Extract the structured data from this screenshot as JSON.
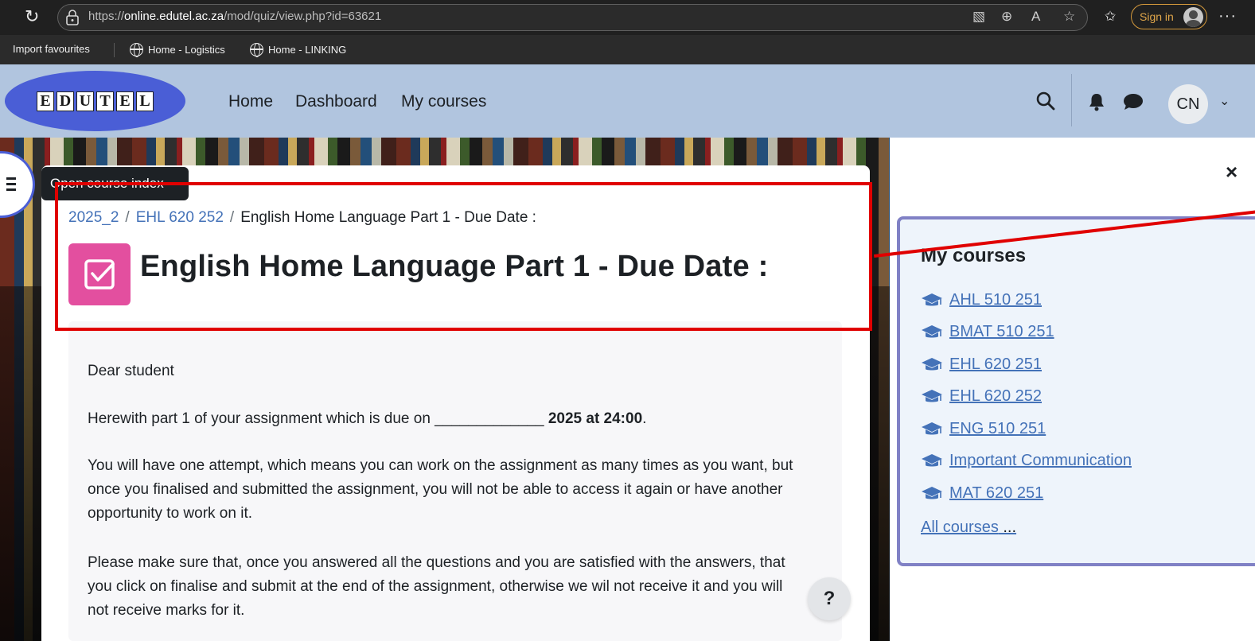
{
  "browser": {
    "url_prefix": "https://",
    "url_domain": "online.edutel.ac.za",
    "url_path": "/mod/quiz/view.php?id=63621",
    "sign_in_label": "Sign in",
    "favourites": [
      {
        "label": "Import favourites"
      },
      {
        "label": "Home - Logistics"
      },
      {
        "label": "Home - LINKING"
      }
    ]
  },
  "navbar": {
    "logo_letters": [
      "E",
      "D",
      "U",
      "T",
      "E",
      "L"
    ],
    "links": [
      {
        "label": "Home"
      },
      {
        "label": "Dashboard"
      },
      {
        "label": "My courses"
      }
    ],
    "user_initials": "CN"
  },
  "course_index": {
    "tooltip": "Open course index"
  },
  "breadcrumb": {
    "items": [
      "2025_2",
      "EHL 620 252",
      "English Home Language Part 1 - Due Date :"
    ],
    "separator": "/"
  },
  "page": {
    "title": "English Home Language Part 1 - Due Date :",
    "paragraphs": {
      "p1": "Dear student",
      "p2_start": "Herewith part 1 of your assignment which is due on _____________ ",
      "p2_bold": "2025 at 24:00",
      "p2_end": ".",
      "p3": "You will have one attempt, which means you can work on the assignment as many times as you want, but once you finalised and submitted the assignment, you will not be able to access it again or have another opportunity to work on it.",
      "p4": "Please make sure that, once you answered all the questions and you are satisfied with the answers, that you click on finalise and submit at the end of the assignment, otherwise we wil not receive it and you will not receive marks for it."
    },
    "help_label": "?"
  },
  "drawer": {
    "close_label": "×",
    "title": "My courses",
    "courses": [
      {
        "label": "AHL 510 251"
      },
      {
        "label": "BMAT 510 251"
      },
      {
        "label": "EHL 620 251"
      },
      {
        "label": "EHL 620 252"
      },
      {
        "label": "ENG 510 251"
      },
      {
        "label": "Important Communication"
      },
      {
        "label": "MAT 620 251"
      }
    ],
    "all_courses_label": "All courses",
    "all_courses_suffix": " ..."
  },
  "colors": {
    "navbar_bg": "#b1c5df",
    "link": "#4472b8",
    "activity_icon": "#e34f9f",
    "annotation_red": "#e00000"
  }
}
